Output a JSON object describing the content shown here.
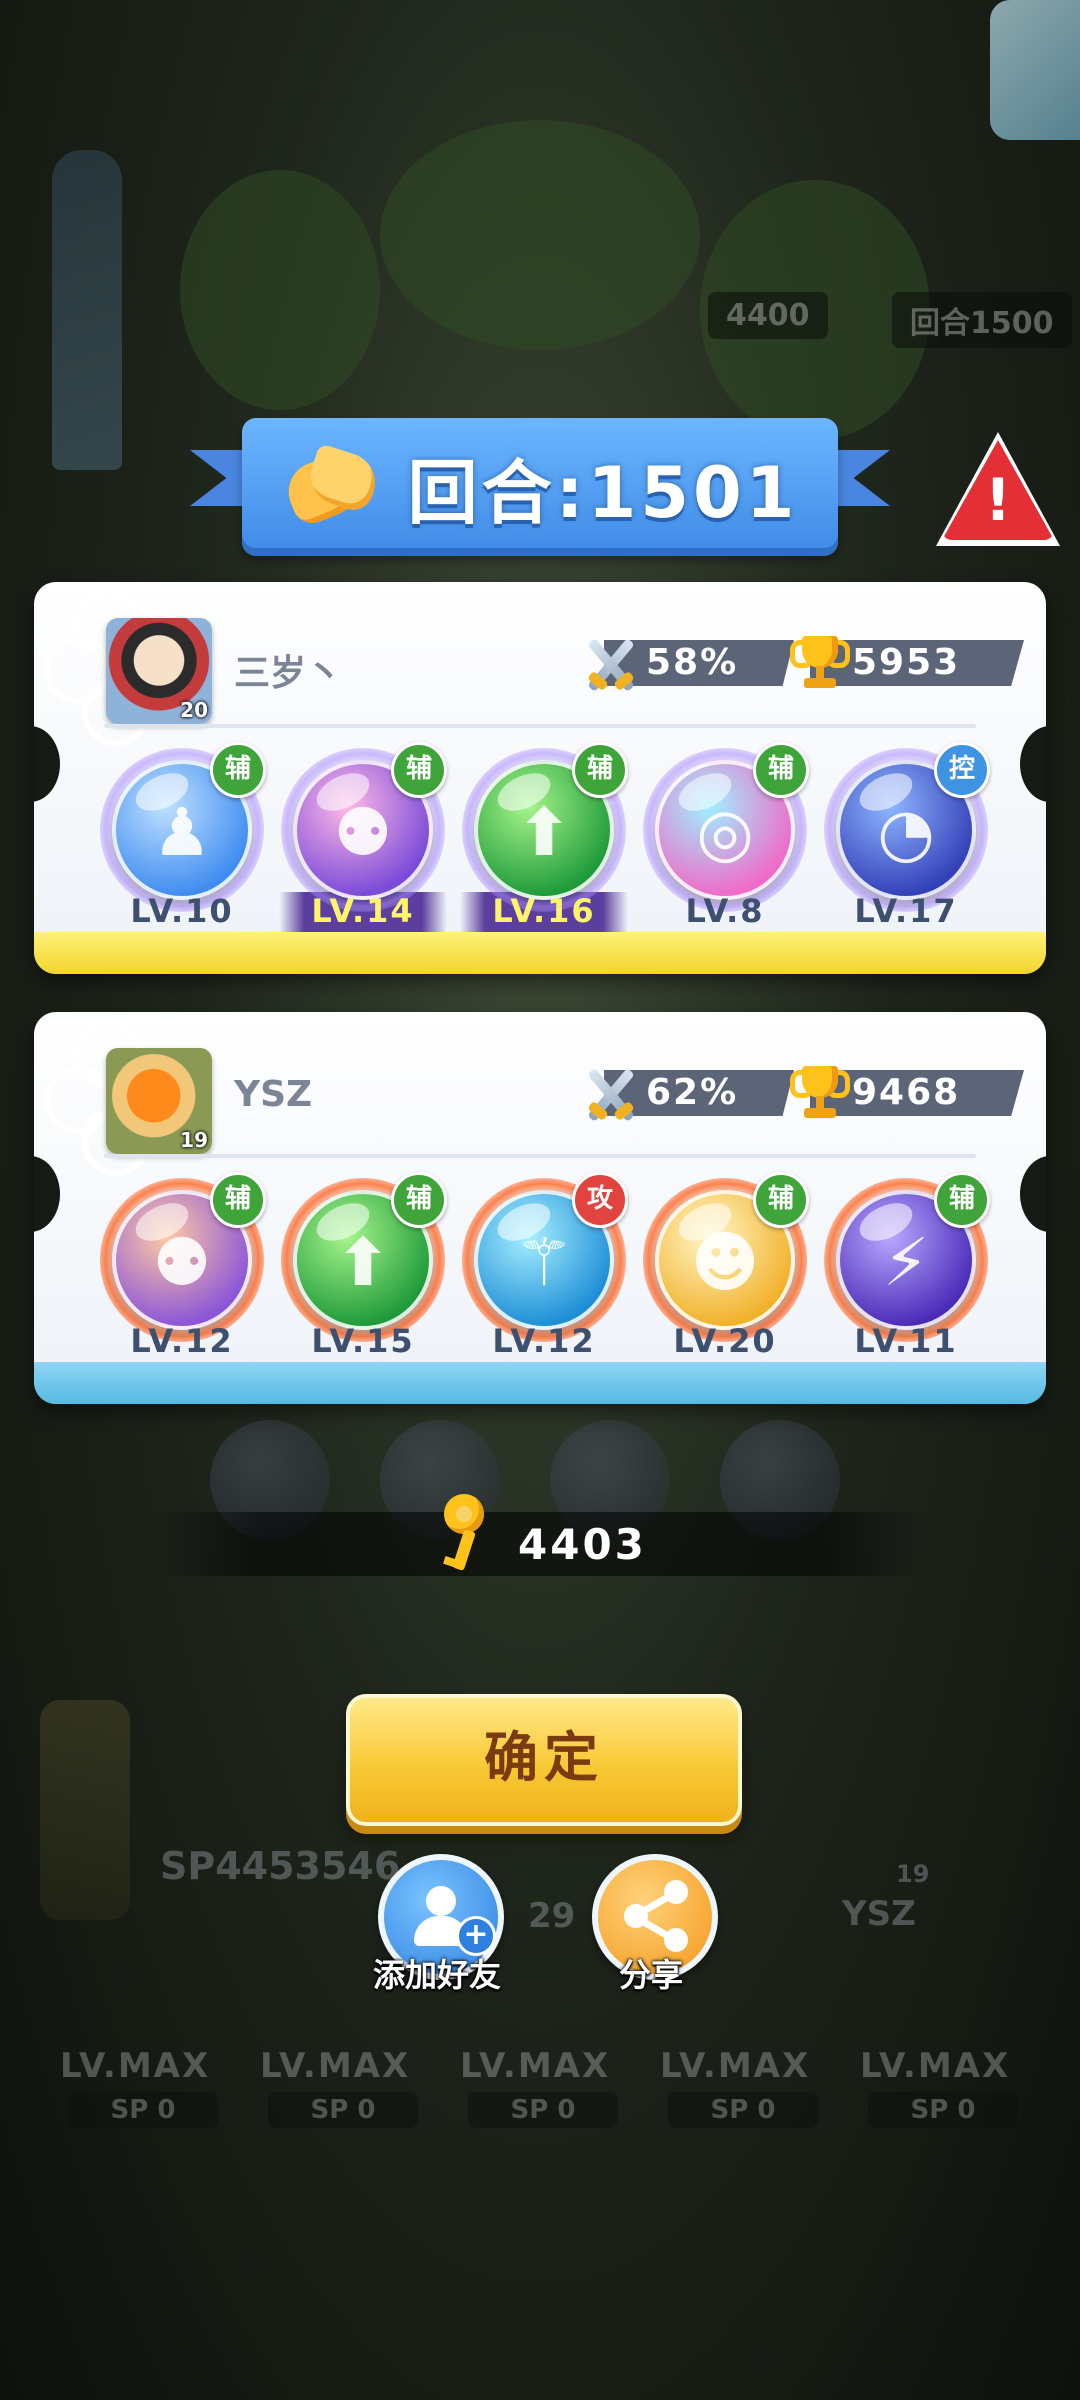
{
  "header": {
    "round_title": "回合:1501"
  },
  "background": {
    "score_pill": "4400",
    "round_pill": "回合1500",
    "player_id": "SP4453546",
    "bg_number": "29",
    "bg_name": "YSZ",
    "bg_avatar_level": "19",
    "bottom_slots": [
      {
        "lv": "LV.MAX",
        "sp_label": "SP",
        "sp_value": "0"
      },
      {
        "lv": "LV.MAX",
        "sp_label": "SP",
        "sp_value": "0"
      },
      {
        "lv": "LV.MAX",
        "sp_label": "SP",
        "sp_value": "0"
      },
      {
        "lv": "LV.MAX",
        "sp_label": "SP",
        "sp_value": "0"
      },
      {
        "lv": "LV.MAX",
        "sp_label": "SP",
        "sp_value": "0"
      }
    ]
  },
  "players": [
    {
      "name": "三岁丶",
      "avatar_level": "20",
      "win_rate": "58%",
      "trophies": "5953",
      "skills": [
        {
          "tag": "辅",
          "tag_color": "#3fa43a",
          "level": "LV.10",
          "highlight": false,
          "orb": [
            "#bfe0ff",
            "#3f8cf0"
          ],
          "glyph": "♟"
        },
        {
          "tag": "辅",
          "tag_color": "#3fa43a",
          "level": "LV.14",
          "highlight": true,
          "orb": [
            "#ffb9e6",
            "#7a4ad8"
          ],
          "glyph": "⚉"
        },
        {
          "tag": "辅",
          "tag_color": "#3fa43a",
          "level": "LV.16",
          "highlight": true,
          "orb": [
            "#a6f58a",
            "#1f9a3a"
          ],
          "glyph": "⬆"
        },
        {
          "tag": "辅",
          "tag_color": "#3fa43a",
          "level": "LV.8",
          "highlight": false,
          "orb": [
            "#9ff0ff",
            "#f06ac7"
          ],
          "glyph": "◎"
        },
        {
          "tag": "控",
          "tag_color": "#3e93e2",
          "level": "LV.17",
          "highlight": false,
          "orb": [
            "#8fb6ff",
            "#3340b8"
          ],
          "glyph": "◔"
        }
      ]
    },
    {
      "name": "YSZ",
      "avatar_level": "19",
      "win_rate": "62%",
      "trophies": "9468",
      "skills": [
        {
          "tag": "辅",
          "tag_color": "#3fa43a",
          "level": "LV.12",
          "highlight": false,
          "orb": [
            "#ffc9a4",
            "#8b55d8"
          ],
          "glyph": "⚉"
        },
        {
          "tag": "辅",
          "tag_color": "#3fa43a",
          "level": "LV.15",
          "highlight": false,
          "orb": [
            "#a6f58a",
            "#1f9a3a"
          ],
          "glyph": "⬆"
        },
        {
          "tag": "攻",
          "tag_color": "#e2433e",
          "level": "LV.12",
          "highlight": false,
          "orb": [
            "#a8f0ff",
            "#1d8ed6"
          ],
          "glyph": "⚚"
        },
        {
          "tag": "辅",
          "tag_color": "#3fa43a",
          "level": "LV.20",
          "highlight": false,
          "orb": [
            "#fff7c7",
            "#f1b12a"
          ],
          "glyph": "☻"
        },
        {
          "tag": "辅",
          "tag_color": "#3fa43a",
          "level": "LV.11",
          "highlight": false,
          "orb": [
            "#b9a8ff",
            "#4a2bb8"
          ],
          "glyph": "⚡"
        }
      ]
    }
  ],
  "keys": {
    "value": "4403"
  },
  "actions": {
    "confirm_label": "确定",
    "add_friend_label": "添加好友",
    "share_label": "分享"
  },
  "colors": {
    "card1_strip": "#f2d42c",
    "card2_strip": "#55b9e4",
    "ribbon": "#4a90e8",
    "warning": "#e32f35"
  },
  "icons": {
    "header": "handshake-icon",
    "warning": "warning-icon",
    "win_rate": "crossed-swords-icon",
    "trophies": "trophy-icon",
    "keys": "key-icon",
    "add_friend": "add-friend-icon",
    "share": "share-icon"
  }
}
